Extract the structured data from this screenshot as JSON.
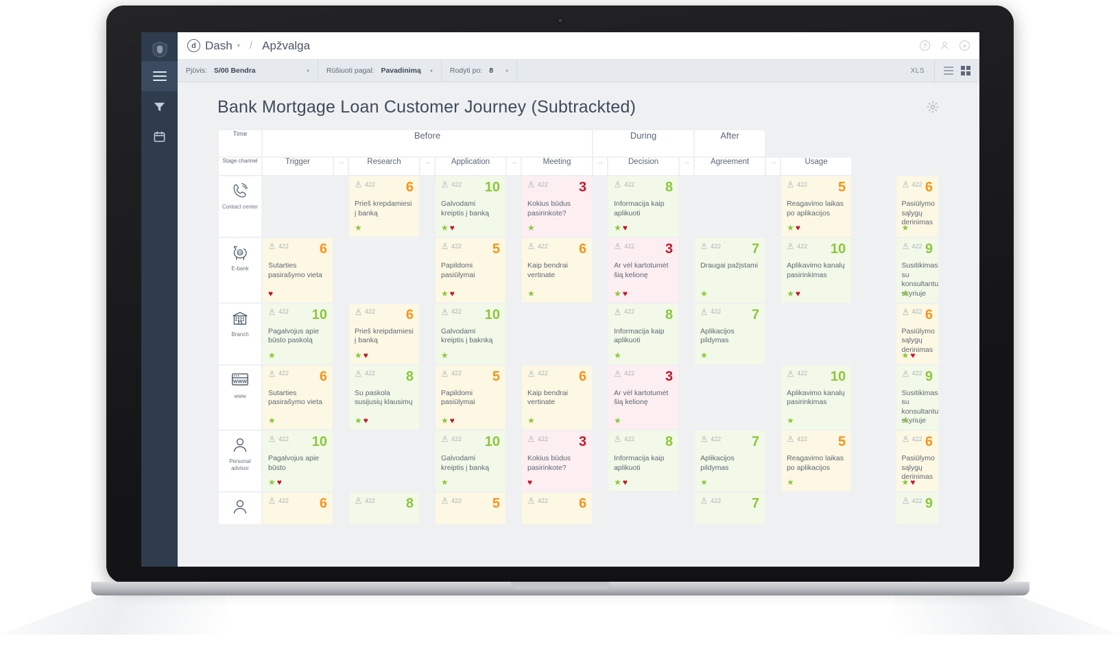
{
  "app": {
    "brand_mark": "d",
    "brand_name": "Dash",
    "breadcrumb_separator": "/",
    "breadcrumb_current": "Apžvalga",
    "help_icon": "?",
    "user_icon": "user-icon",
    "close_icon": "×"
  },
  "filters": {
    "view": {
      "label": "Pjūvis:",
      "value": "S/00 Bendra"
    },
    "sort": {
      "label": "Rūšiuoti pagal:",
      "value": "Pavadinimą"
    },
    "show": {
      "label": "Rodyti po:",
      "value": "8"
    },
    "export_label": "XLS",
    "view_list_label": "list-view",
    "view_grid_label": "grid-view"
  },
  "page": {
    "title": "Bank Mortgage Loan Customer Journey (Subtrackted)",
    "settings_label": "settings"
  },
  "table": {
    "corner_time": "Time",
    "corner_stage": "Stage channel",
    "phases": [
      {
        "label": "Before",
        "span": 4
      },
      {
        "label": "During",
        "span": 2
      },
      {
        "label": "After",
        "span": 1
      }
    ],
    "stages": [
      "Trigger",
      "Research",
      "Application",
      "Meeting",
      "Decision",
      "Agreement",
      "Usage"
    ],
    "arrow_glyph": "→",
    "people_count": "422",
    "rows": [
      {
        "channel": "Contact center",
        "icon": "phone-icon",
        "cells": [
          {
            "empty": true
          },
          {
            "score": "6",
            "tone": "orange",
            "bg": "yellow",
            "text": "Prieš krepdamiesi į banką",
            "star": true,
            "heart": false
          },
          {
            "score": "10",
            "tone": "green",
            "bg": "green",
            "text": "Galvodami kreiptis į banką",
            "star": true,
            "heart": true
          },
          {
            "score": "3",
            "tone": "red",
            "bg": "pink",
            "text": "Kokius būdus pasirinkote?",
            "star": true,
            "heart": false
          },
          {
            "score": "8",
            "tone": "green",
            "bg": "green",
            "text": "Informacija kaip aplikuoti",
            "star": true,
            "heart": true
          },
          {
            "empty": true
          },
          {
            "score": "5",
            "tone": "orange",
            "bg": "yellow",
            "text": "Reagavimo laikas po aplikacijos",
            "star": true,
            "heart": true
          },
          {
            "score": "6",
            "tone": "orange",
            "bg": "yellow",
            "text": "Pasiūlymo sąlygų derinimas",
            "star": true,
            "heart": false
          }
        ]
      },
      {
        "channel": "E-bank",
        "icon": "piggy-bank-icon",
        "cells": [
          {
            "score": "6",
            "tone": "orange",
            "bg": "yellow",
            "text": "Sutarties pasirašymo vieta",
            "star": false,
            "heart": true
          },
          {
            "empty": true
          },
          {
            "score": "5",
            "tone": "orange",
            "bg": "yellow",
            "text": "Papildomi pasiūlymai",
            "star": true,
            "heart": true
          },
          {
            "score": "6",
            "tone": "orange",
            "bg": "yellow",
            "text": "Kaip bendrai vertinate",
            "star": true,
            "heart": false
          },
          {
            "score": "3",
            "tone": "red",
            "bg": "pink",
            "text": "Ar vėl kartotumėt šią kelionę",
            "star": true,
            "heart": true
          },
          {
            "score": "7",
            "tone": "green",
            "bg": "green",
            "text": "Draugai pažįstami",
            "star": true,
            "heart": false
          },
          {
            "score": "10",
            "tone": "green",
            "bg": "green",
            "text": "Aplikavimo kanalų pasirinkimas",
            "star": true,
            "heart": true
          },
          {
            "score": "9",
            "tone": "green",
            "bg": "green",
            "text": "Susitikimas su konsultantu skyriuje",
            "star": true,
            "heart": false
          }
        ]
      },
      {
        "channel": "Branch",
        "icon": "building-icon",
        "cells": [
          {
            "score": "10",
            "tone": "green",
            "bg": "green",
            "text": "Pagalvojus apie būsto paskolą",
            "star": true,
            "heart": false
          },
          {
            "score": "6",
            "tone": "orange",
            "bg": "yellow",
            "text": "Prieš kreipdamiesi į banką",
            "star": true,
            "heart": true
          },
          {
            "score": "10",
            "tone": "green",
            "bg": "green",
            "text": "Galvodami kreiptis į baknką",
            "star": true,
            "heart": false
          },
          {
            "empty": true
          },
          {
            "score": "8",
            "tone": "green",
            "bg": "green",
            "text": "Informacija kaip aplikuoti",
            "star": true,
            "heart": false
          },
          {
            "score": "7",
            "tone": "green",
            "bg": "green",
            "text": "Aplikacijos pildymas",
            "star": true,
            "heart": false
          },
          {
            "empty": true
          },
          {
            "score": "6",
            "tone": "orange",
            "bg": "yellow",
            "text": "Pasiūlymo sąlygų derinimas",
            "star": true,
            "heart": true
          }
        ]
      },
      {
        "channel": "www",
        "icon": "browser-www-icon",
        "cells": [
          {
            "score": "6",
            "tone": "orange",
            "bg": "yellow",
            "text": "Sutarties pasirašymo vieta",
            "star": true,
            "heart": false
          },
          {
            "score": "8",
            "tone": "green",
            "bg": "green",
            "text": "Su paskola susijusių klausimų",
            "star": true,
            "heart": true
          },
          {
            "score": "5",
            "tone": "orange",
            "bg": "yellow",
            "text": "Papildomi pasiūlymai",
            "star": true,
            "heart": true
          },
          {
            "score": "6",
            "tone": "orange",
            "bg": "yellow",
            "text": "Kaip bendrai vertinate",
            "star": true,
            "heart": false
          },
          {
            "score": "3",
            "tone": "red",
            "bg": "pink",
            "text": "Ar vėl kartotumėt šią kelionę",
            "star": true,
            "heart": false
          },
          {
            "empty": true
          },
          {
            "score": "10",
            "tone": "green",
            "bg": "green",
            "text": "Aplikavimo kanalų pasirinkimas",
            "star": true,
            "heart": false
          },
          {
            "score": "9",
            "tone": "green",
            "bg": "green",
            "text": "Susitikimas su konsultantu skyriuje",
            "star": true,
            "heart": false
          }
        ]
      },
      {
        "channel": "Personal advisor",
        "icon": "person-icon",
        "cells": [
          {
            "score": "10",
            "tone": "green",
            "bg": "green",
            "text": "Pagalvojus apie būsto",
            "star": true,
            "heart": true
          },
          {
            "empty": true
          },
          {
            "score": "10",
            "tone": "green",
            "bg": "green",
            "text": "Galvodami kreiptis į banką",
            "star": true,
            "heart": false
          },
          {
            "score": "3",
            "tone": "red",
            "bg": "pink",
            "text": "Kokius būdus pasirinkote?",
            "star": false,
            "heart": true
          },
          {
            "score": "8",
            "tone": "green",
            "bg": "green",
            "text": "Informacija kaip aplikuoti",
            "star": true,
            "heart": true
          },
          {
            "score": "7",
            "tone": "green",
            "bg": "green",
            "text": "Aplikacijos pildymas",
            "star": true,
            "heart": false
          },
          {
            "score": "5",
            "tone": "orange",
            "bg": "yellow",
            "text": "Reagavimo laikas po aplikacijos",
            "star": true,
            "heart": false
          },
          {
            "score": "6",
            "tone": "orange",
            "bg": "yellow",
            "text": "Pasiūlymo sąlygų derinimas",
            "star": true,
            "heart": true
          }
        ]
      },
      {
        "channel": "",
        "icon": "person-icon",
        "partial": true,
        "cells": [
          {
            "score": "6",
            "tone": "orange",
            "bg": "yellow",
            "text": "",
            "star": false,
            "heart": false
          },
          {
            "score": "8",
            "tone": "green",
            "bg": "green",
            "text": "",
            "star": false,
            "heart": false
          },
          {
            "score": "5",
            "tone": "orange",
            "bg": "yellow",
            "text": "",
            "star": false,
            "heart": false
          },
          {
            "score": "6",
            "tone": "orange",
            "bg": "yellow",
            "text": "",
            "star": false,
            "heart": false
          },
          {
            "empty": true
          },
          {
            "score": "7",
            "tone": "green",
            "bg": "green",
            "text": "",
            "star": false,
            "heart": false
          },
          {
            "empty": true
          },
          {
            "score": "9",
            "tone": "green",
            "bg": "green",
            "text": "",
            "star": false,
            "heart": false
          }
        ]
      }
    ]
  },
  "colors": {
    "accent_green": "#8cc63e",
    "accent_orange": "#f7941d",
    "accent_red": "#c2192b",
    "rail": "#2f3c4e",
    "bg_yellow": "#fdf8e3",
    "bg_green": "#f3f9e8",
    "bg_pink": "#fdeef1",
    "bg_grey": "#eff1f3"
  }
}
